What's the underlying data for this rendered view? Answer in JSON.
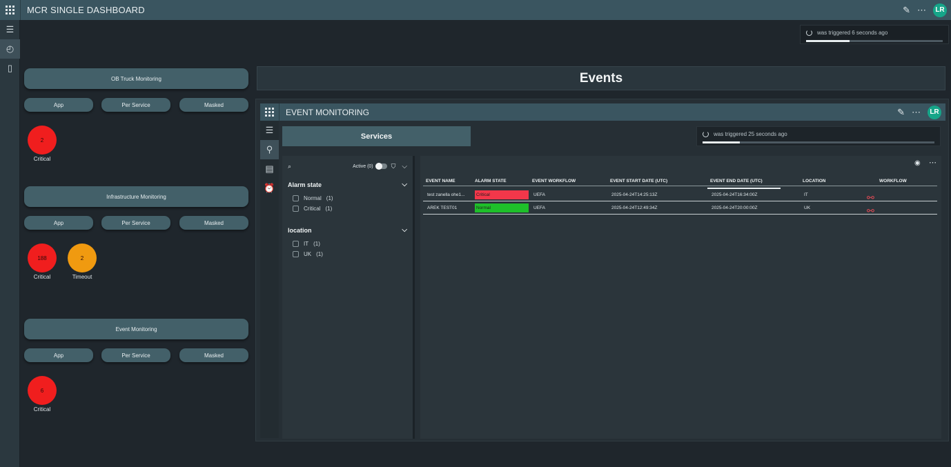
{
  "app": {
    "title": "MCR SINGLE DASHBOARD",
    "avatar": "LR"
  },
  "trigger_main": {
    "text": "was triggered 6 seconds ago",
    "progress": 0.32
  },
  "groups": [
    {
      "title": "OB Truck Monitoring",
      "buttons": [
        "App",
        "Per Service",
        "Masked"
      ],
      "stats": [
        {
          "value": "2",
          "label": "Critical",
          "color": "#f01e1e"
        }
      ]
    },
    {
      "title": "Infrastructure Monitoring",
      "buttons": [
        "App",
        "Per Service",
        "Masked"
      ],
      "stats": [
        {
          "value": "188",
          "label": "Critical",
          "color": "#f01e1e"
        },
        {
          "value": "2",
          "label": "Timeout",
          "color": "#f09a10"
        }
      ]
    },
    {
      "title": "Event Monitoring",
      "buttons": [
        "App",
        "Per Service",
        "Masked"
      ],
      "stats": [
        {
          "value": "6",
          "label": "Critical",
          "color": "#f01e1e"
        }
      ]
    }
  ],
  "events_title": "Events",
  "embedded": {
    "title": "EVENT MONITORING",
    "avatar": "LR",
    "services_label": "Services",
    "trigger": {
      "text": "was triggered 25 seconds ago",
      "progress": 0.16
    },
    "filter": {
      "active_label": "Active (0)",
      "sections": [
        {
          "title": "Alarm state",
          "options": [
            {
              "label": "Normal",
              "count": "(1)"
            },
            {
              "label": "Critical",
              "count": "(1)"
            }
          ]
        },
        {
          "title": "location",
          "options": [
            {
              "label": "IT",
              "count": "(1)"
            },
            {
              "label": "UK",
              "count": "(1)"
            }
          ]
        }
      ]
    },
    "table": {
      "columns": [
        "EVENT NAME",
        "ALARM STATE",
        "EVENT WORKFLOW",
        "EVENT START DATE (UTC)",
        "EVENT END DATE (UTC)",
        "LOCATION",
        "WORKFLOW"
      ],
      "rows": [
        {
          "name": "test zanella ohe1...",
          "state": "Critical",
          "state_color": "#f2374a",
          "workflow": "UEFA",
          "start": "2025-04-24T14:25:13Z",
          "end": "2025-04-24T16:34:00Z",
          "location": "IT"
        },
        {
          "name": "AREK TEST01",
          "state": "Normal",
          "state_color": "#1ec02a",
          "workflow": "UEFA",
          "start": "2025-04-24T12:49:34Z",
          "end": "2025-04-24T20:00:00Z",
          "location": "UK"
        }
      ]
    }
  }
}
